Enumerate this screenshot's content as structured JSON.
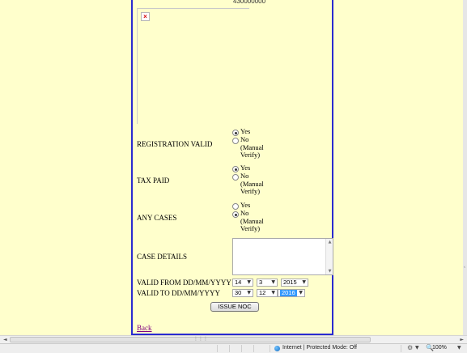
{
  "form": {
    "top_number": "430000000",
    "registration": {
      "label": "REGISTRATION VALID",
      "options": [
        {
          "label": "Yes",
          "checked": true
        },
        {
          "label": "No (Manual Verify)",
          "checked": false
        }
      ]
    },
    "tax": {
      "label": "TAX PAID",
      "options": [
        {
          "label": "Yes",
          "checked": true
        },
        {
          "label": "No (Manual Verify)",
          "checked": false
        }
      ]
    },
    "cases": {
      "label": "ANY CASES",
      "options": [
        {
          "label": "Yes",
          "checked": false
        },
        {
          "label": "No (Manual Verify)",
          "checked": true
        }
      ]
    },
    "case_details": {
      "label": "CASE DETAILS",
      "value": ""
    },
    "valid_from": {
      "label": "VALID FROM DD/MM/YYYY",
      "day": "14",
      "month": "3",
      "year": "2015"
    },
    "valid_to": {
      "label": "VALID TO DD/MM/YYYY",
      "day": "30",
      "month": "12",
      "year": "2016"
    },
    "issue_button": "ISSUE NOC",
    "back_link": "Back"
  },
  "statusbar": {
    "zone": "Internet | Protected Mode: Off",
    "zoom": "100%"
  },
  "icons": {
    "broken_image": "broken-image-icon",
    "globe": "globe-icon",
    "settings": "settings-icon",
    "zoom": "zoom-icon"
  },
  "colors": {
    "page_background": "#ffffcc",
    "panel_border": "#2a2ad0",
    "link_visited": "#800080",
    "selection": "#3399ff"
  }
}
